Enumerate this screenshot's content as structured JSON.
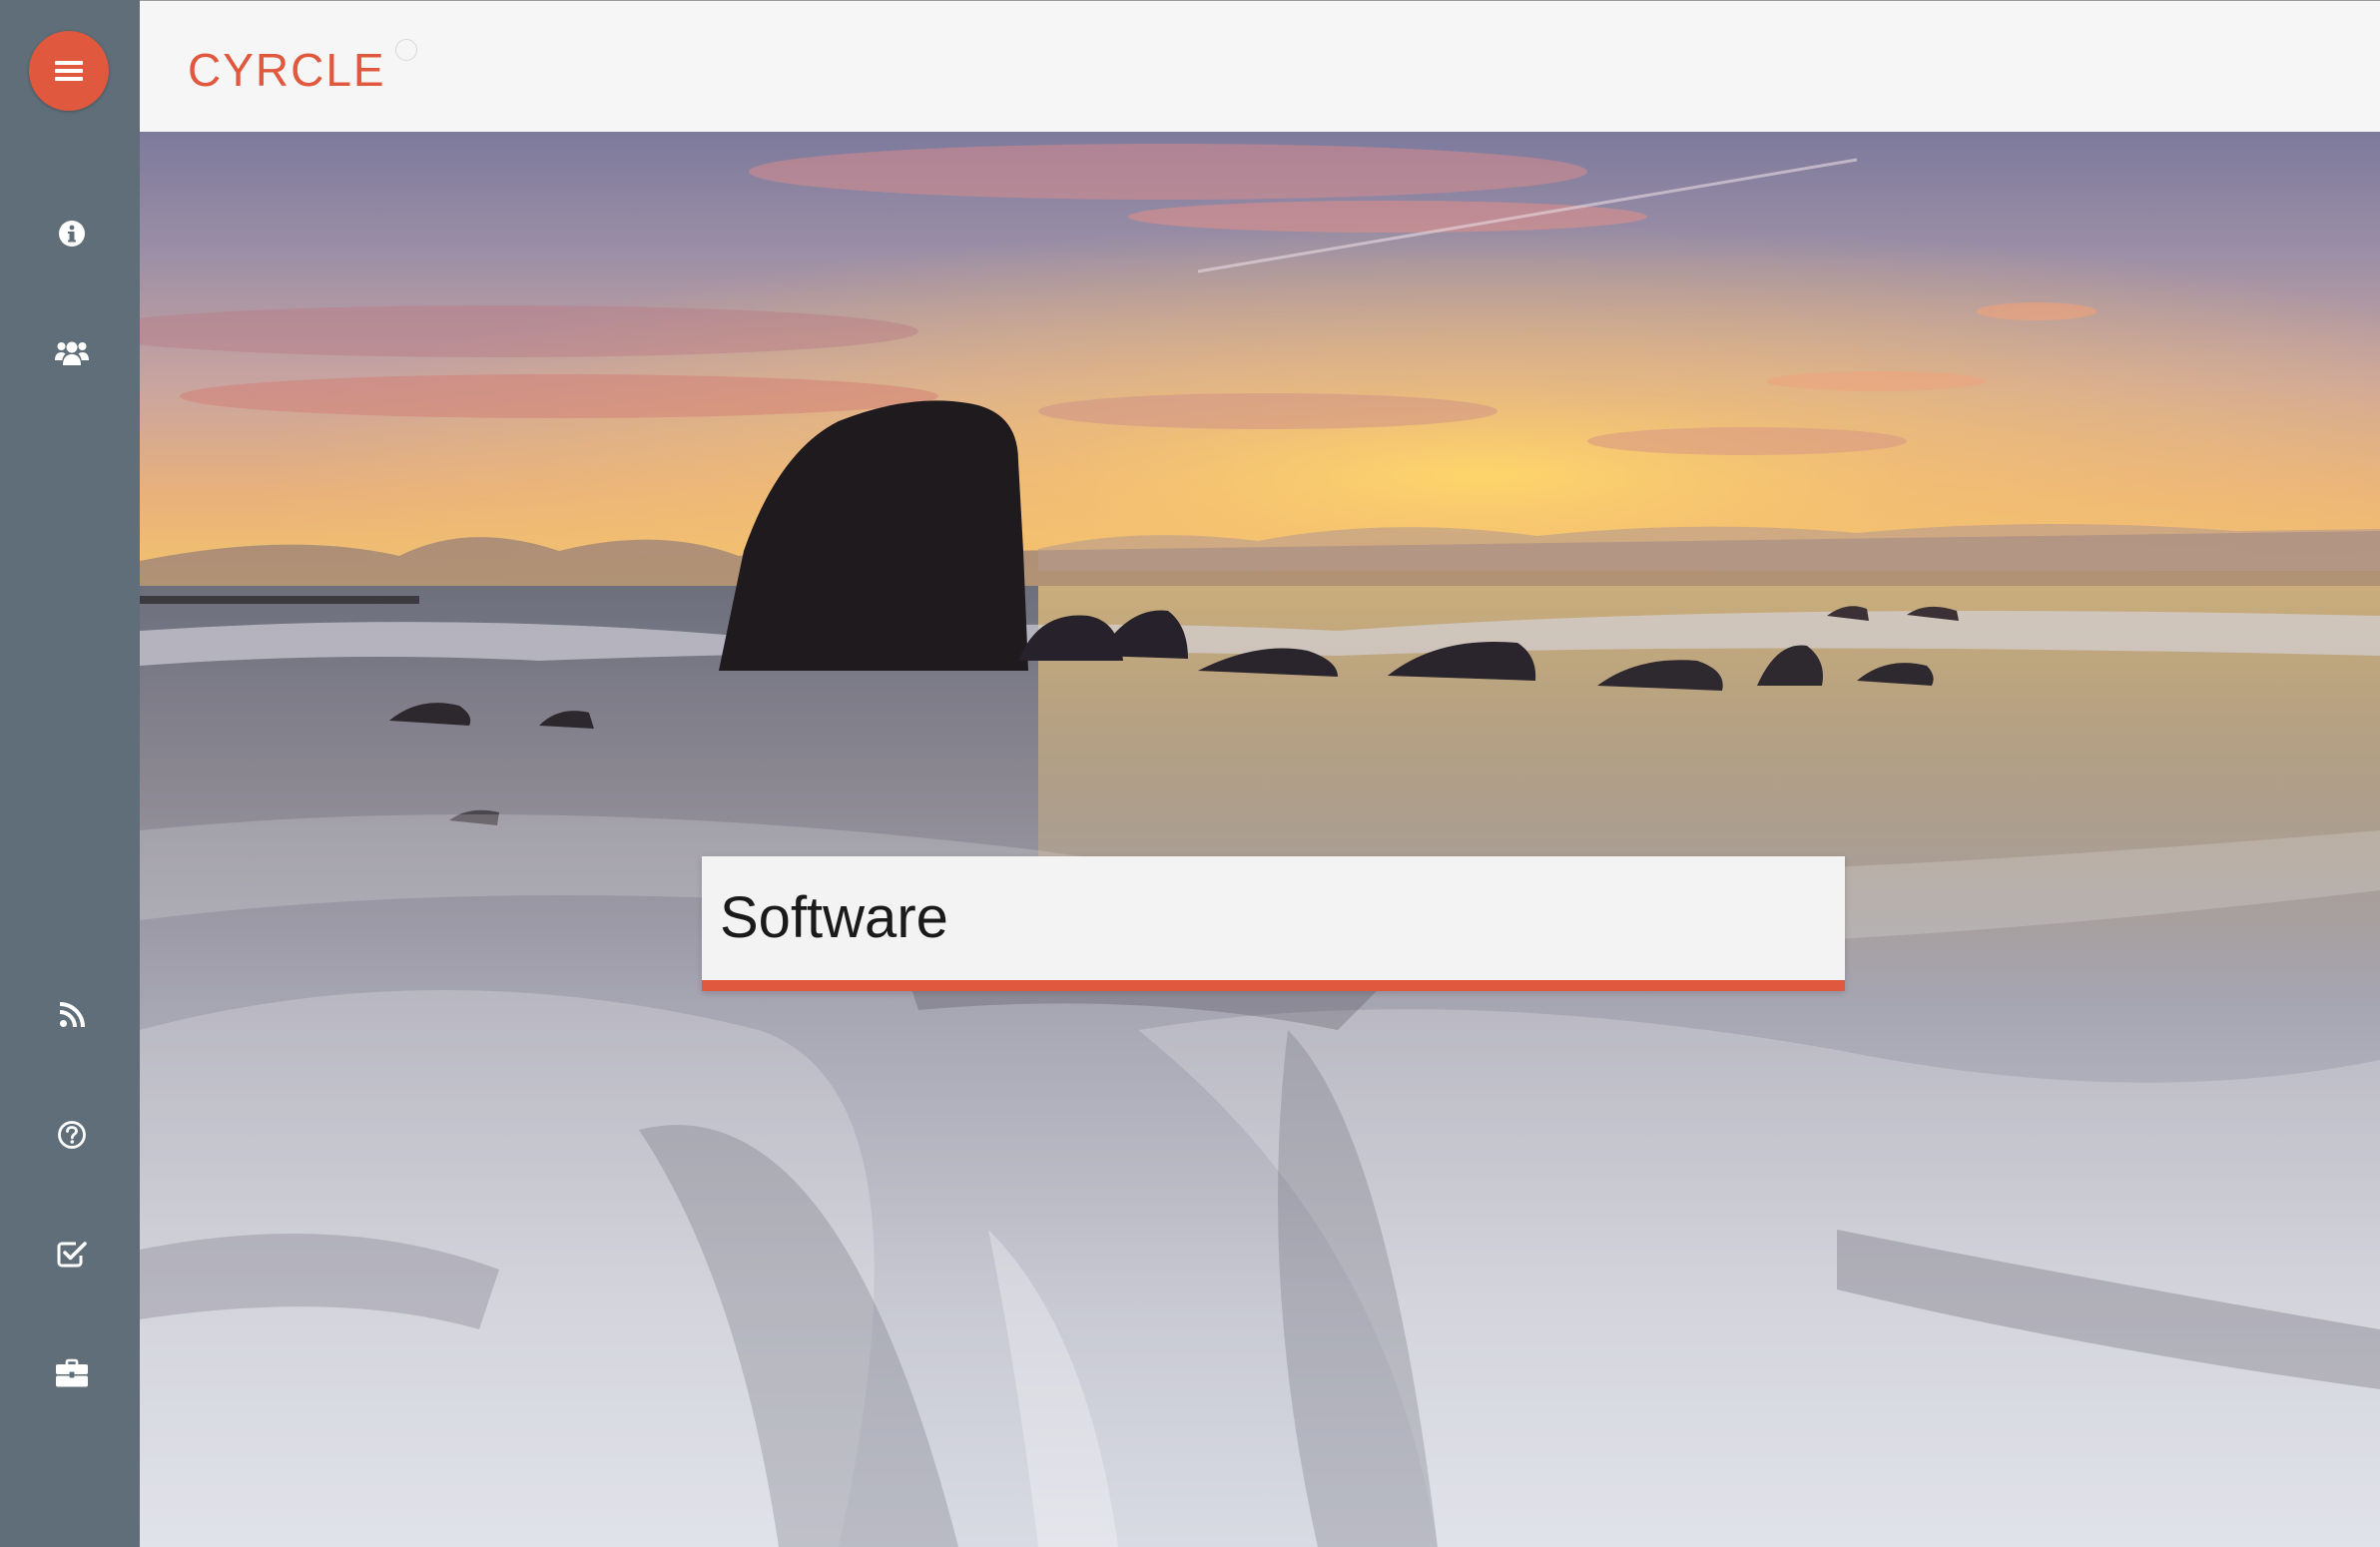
{
  "app": {
    "logo_text": "CYRCLE",
    "accent_color": "#e0583e",
    "sidebar_color": "#5f6e78"
  },
  "sidebar": {
    "menu_button": {
      "icon": "hamburger-menu-icon"
    },
    "top_items": [
      {
        "icon": "info-icon"
      },
      {
        "icon": "users-group-icon"
      }
    ],
    "bottom_items": [
      {
        "icon": "rss-feed-icon"
      },
      {
        "icon": "help-question-icon"
      },
      {
        "icon": "checkbox-icon"
      },
      {
        "icon": "briefcase-icon"
      }
    ]
  },
  "hero": {
    "background": "ocean-sunset-rock-photo"
  },
  "search": {
    "value": "Software",
    "underline_color": "#e0583e"
  }
}
